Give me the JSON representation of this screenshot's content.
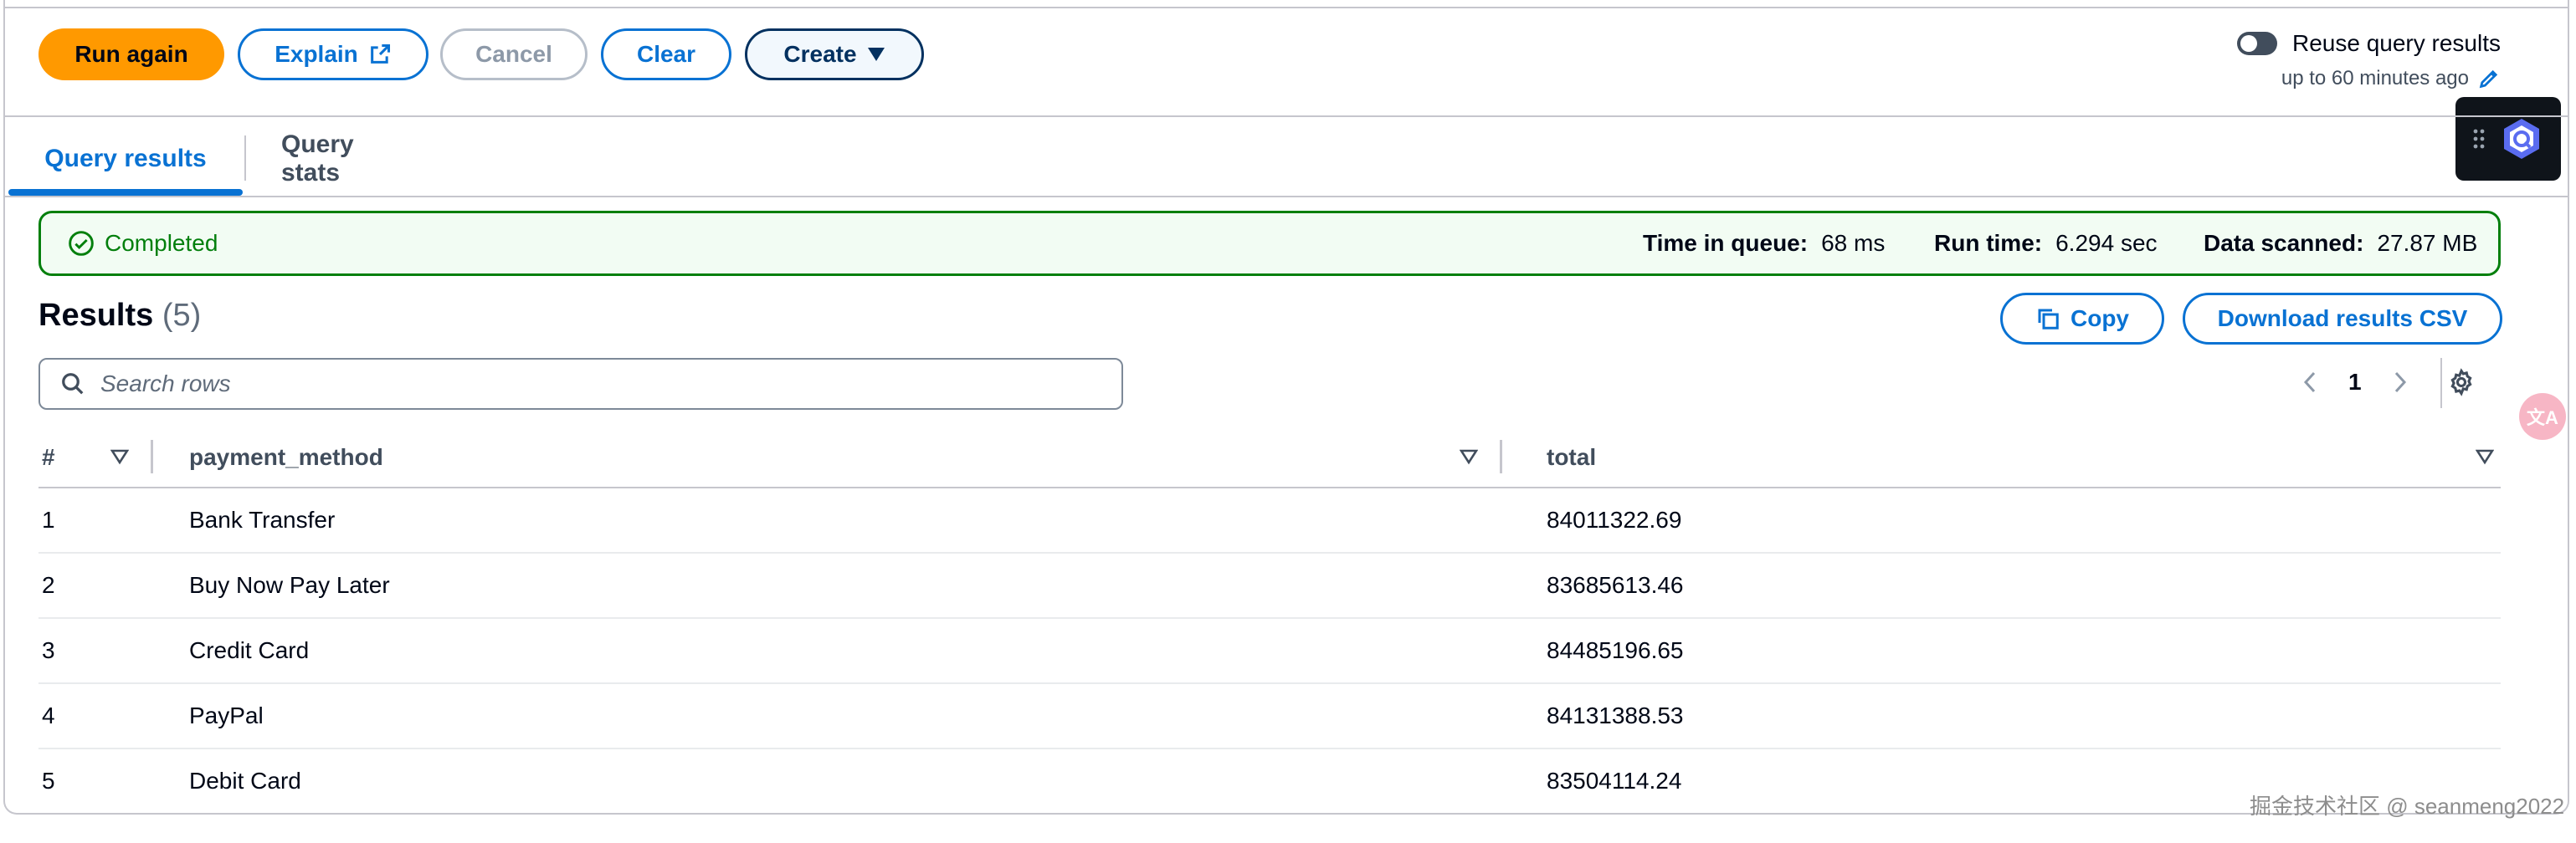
{
  "toolbar": {
    "run_again": "Run again",
    "explain": "Explain",
    "cancel": "Cancel",
    "clear": "Clear",
    "create": "Create",
    "reuse_label": "Reuse query results",
    "reuse_sub": "up to 60 minutes ago",
    "reuse_enabled": false
  },
  "tabs": [
    {
      "label": "Query results",
      "active": true
    },
    {
      "label": "Query stats",
      "active": false
    }
  ],
  "status": {
    "state": "Completed",
    "time_in_queue_label": "Time in queue:",
    "time_in_queue_value": "68 ms",
    "run_time_label": "Run time:",
    "run_time_value": "6.294 sec",
    "data_scanned_label": "Data scanned:",
    "data_scanned_value": "27.87 MB"
  },
  "results": {
    "title": "Results",
    "count": "(5)",
    "copy": "Copy",
    "download": "Download results CSV",
    "search_placeholder": "Search rows",
    "page": "1"
  },
  "table": {
    "columns": [
      "#",
      "payment_method",
      "total"
    ],
    "rows": [
      [
        "1",
        "Bank Transfer",
        "84011322.69"
      ],
      [
        "2",
        "Buy Now Pay Later",
        "83685613.46"
      ],
      [
        "3",
        "Credit Card",
        "84485196.65"
      ],
      [
        "4",
        "PayPal",
        "84131388.53"
      ],
      [
        "5",
        "Debit Card",
        "83504114.24"
      ]
    ]
  },
  "overlay": {
    "watermark": "掘金技术社区 @ seanmeng2022",
    "translate_glyph": "文A"
  },
  "colors": {
    "accent": "#0972d3",
    "primary": "#ff9900",
    "success": "#037f0c"
  }
}
